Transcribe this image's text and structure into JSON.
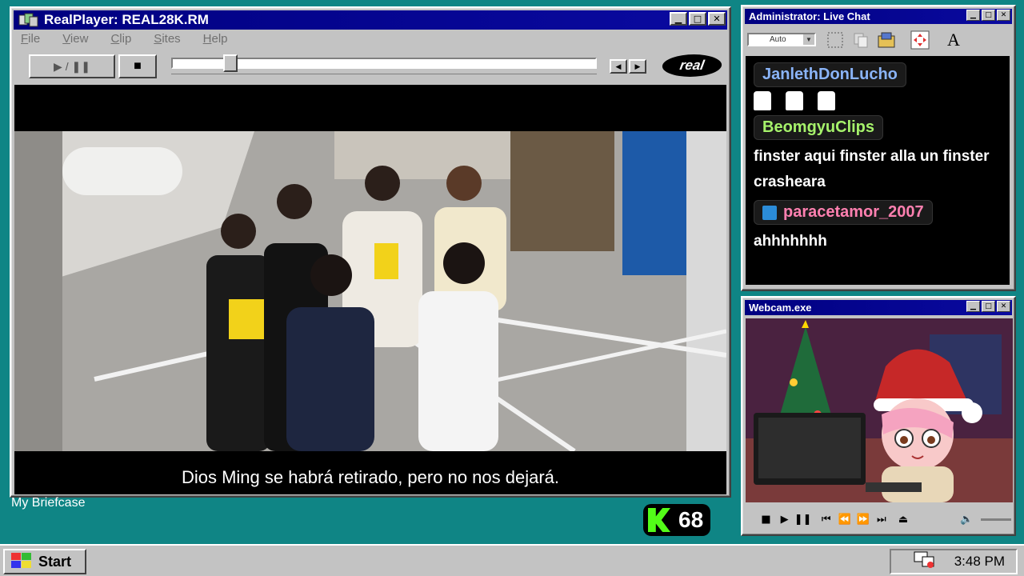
{
  "realplayer": {
    "title": "RealPlayer: REAL28K.RM",
    "menu": [
      "File",
      "View",
      "Clip",
      "Sites",
      "Help"
    ],
    "play_pause_label": "▶ / ❚❚",
    "stop_label": "■",
    "progress": 0.14,
    "logo_text": "real",
    "subtitle": "Dios Ming se habrá retirado, pero no nos dejará."
  },
  "desktop": {
    "icon_label": "My Briefcase"
  },
  "kick_badge": {
    "count": "68"
  },
  "chat": {
    "title": "Administrator: Live Chat",
    "font_select": "Auto",
    "font_icon_label": "A",
    "messages": [
      {
        "user": "JanlethDonLucho",
        "user_color": "#8ab4f8",
        "text": "",
        "emote_count": 3
      },
      {
        "user": "BeomgyuClips",
        "user_color": "#a6f26b",
        "text": "finster aqui finster alla un finster crasheara",
        "emote_count": 0
      },
      {
        "user": "paracetamor_2007",
        "user_color": "#ff80b0",
        "text": "ahhhhhhh",
        "emote_count": 0
      }
    ]
  },
  "webcam": {
    "title": "Webcam.exe"
  },
  "taskbar": {
    "start_label": "Start",
    "clock": "3:48 PM"
  },
  "colors": {
    "desktop": "#0f8585",
    "title_active": "#000080",
    "face": "#c3c3c3",
    "kick_green": "#53fc18"
  }
}
